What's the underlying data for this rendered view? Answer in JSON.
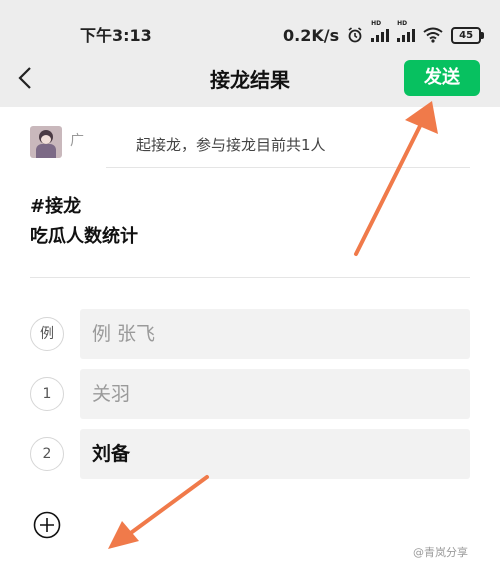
{
  "status_bar": {
    "time": "下午3:13",
    "network_speed": "0.2K/s",
    "battery": "45"
  },
  "nav": {
    "title": "接龙结果",
    "send_label": "发送"
  },
  "initiator": {
    "name": "广",
    "text": "起接龙，参与接龙目前共1人"
  },
  "content": {
    "line1": "#接龙",
    "line2": "吃瓜人数统计"
  },
  "entries": [
    {
      "index": "例",
      "text": "例 张飞",
      "is_placeholder": true
    },
    {
      "index": "1",
      "text": "关羽",
      "is_placeholder": true
    },
    {
      "index": "2",
      "text": "刘备",
      "is_placeholder": false
    }
  ],
  "colors": {
    "send_button": "#07c160",
    "annotation_arrow": "#f07a4a",
    "header_background": "#ededed"
  },
  "watermark": "@青岚分享"
}
